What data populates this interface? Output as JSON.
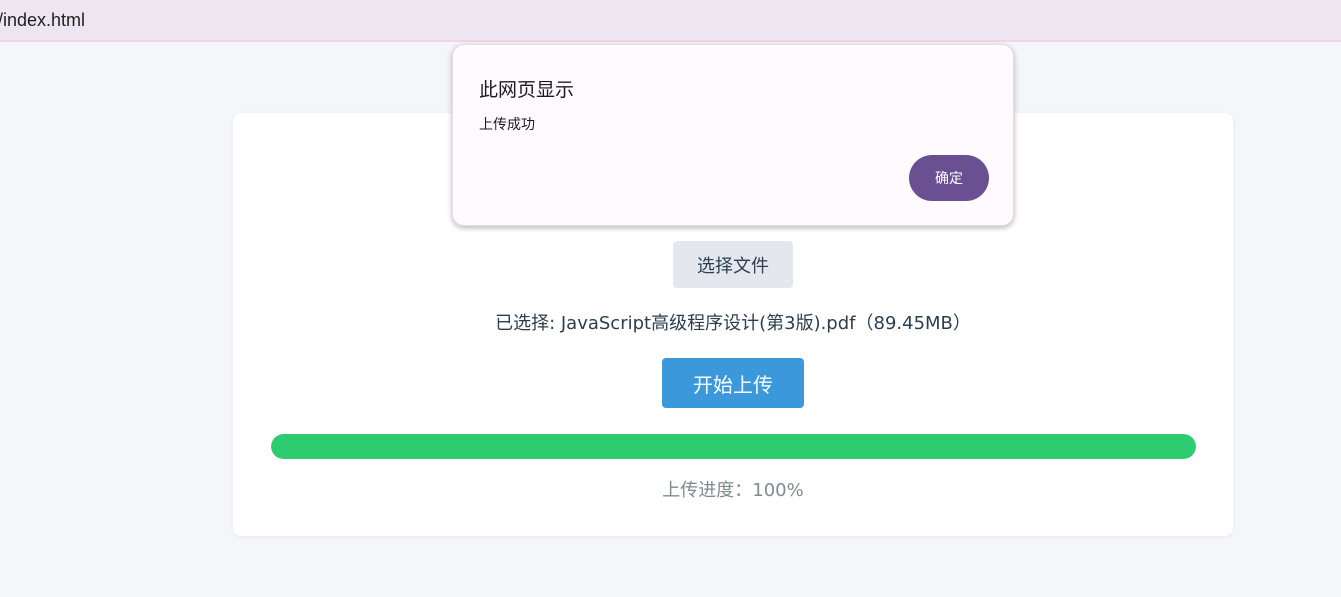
{
  "browser": {
    "url": "/index.html"
  },
  "card": {
    "choose_button_label": "选择文件",
    "selected_text": "已选择: JavaScript高级程序设计(第3版).pdf（89.45MB）",
    "upload_button_label": "开始上传",
    "progress_percent": 100,
    "progress_text": "上传进度：100%"
  },
  "dialog": {
    "title": "此网页显示",
    "message": "上传成功",
    "ok_label": "确定"
  },
  "colors": {
    "page_bg": "#f5f6f9",
    "upload_button": "#3a98db",
    "progress_fill": "#2ecc71",
    "dialog_ok": "#6b4f93"
  }
}
